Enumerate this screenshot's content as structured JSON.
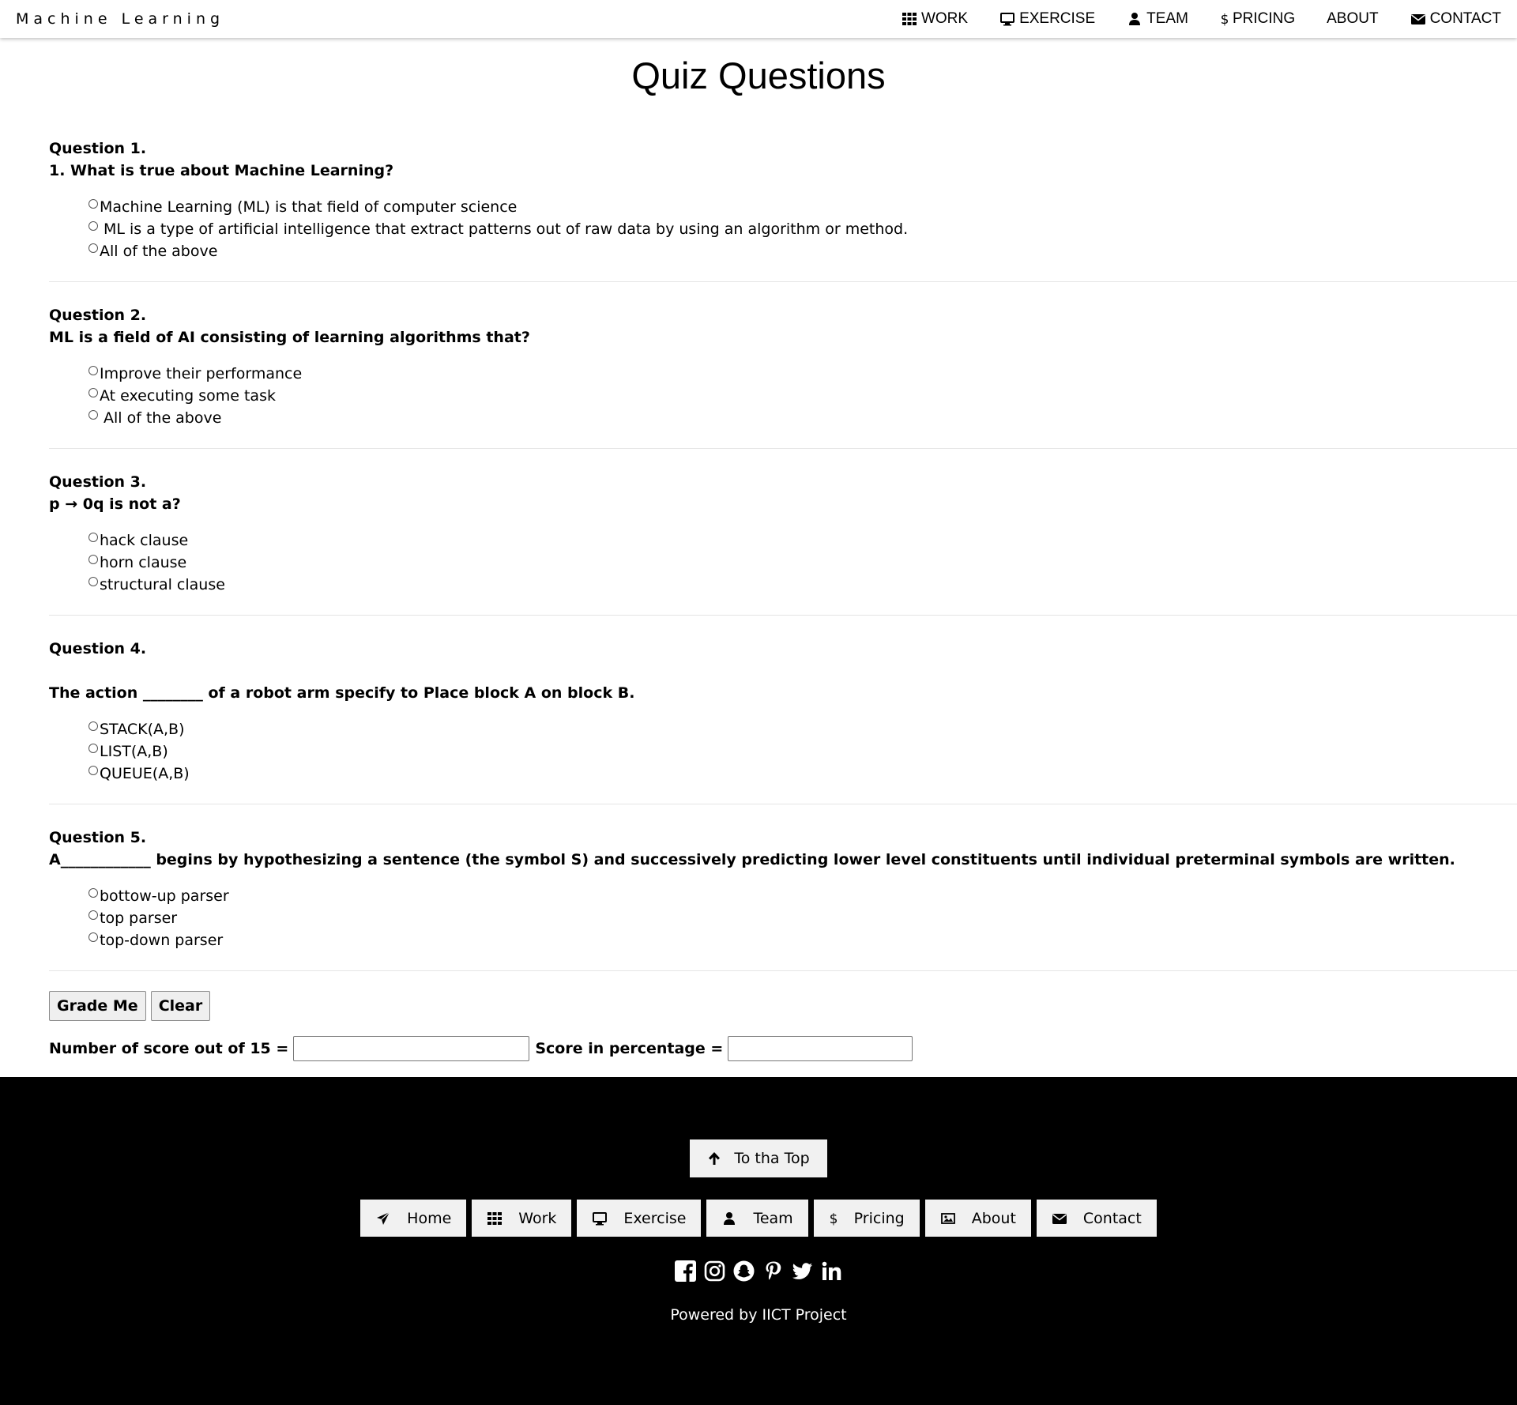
{
  "navbar": {
    "brand": "Machine Learning",
    "items": [
      {
        "label": "WORK",
        "icon": "th-grid-icon"
      },
      {
        "label": "EXERCISE",
        "icon": "desktop-icon"
      },
      {
        "label": "TEAM",
        "icon": "user-icon"
      },
      {
        "label": "PRICING",
        "icon": "dollar-icon"
      },
      {
        "label": "ABOUT",
        "icon": ""
      },
      {
        "label": "CONTACT",
        "icon": "envelope-icon"
      }
    ]
  },
  "main": {
    "title": "Quiz Questions",
    "questions": [
      {
        "number": "Question 1.",
        "text": "1. What is true about Machine Learning?",
        "options": [
          "Machine Learning (ML) is that field of computer science",
          "ML is a type of artificial intelligence that extract patterns out of raw data by using an algorithm or method.",
          "All of the above"
        ]
      },
      {
        "number": "Question 2.",
        "text": "ML is a field of AI consisting of learning algorithms that?",
        "options": [
          "Improve their performance",
          "At executing some task",
          "All of the above"
        ]
      },
      {
        "number": "Question 3.",
        "text": "p → 0q is not a?",
        "options": [
          "hack clause",
          "horn clause",
          "structural clause"
        ]
      },
      {
        "number": "Question 4.",
        "text": "The action ________ of a robot arm specify to Place block A on block B.",
        "options": [
          "STACK(A,B)",
          "LIST(A,B)",
          "QUEUE(A,B)"
        ]
      },
      {
        "number": "Question 5.",
        "text": "A____________ begins by hypothesizing a sentence (the symbol S) and successively predicting lower level constituents until individual preterminal symbols are written.",
        "options": [
          "bottow-up parser",
          "top parser",
          "top-down parser"
        ]
      }
    ],
    "grade_button": "Grade Me",
    "clear_button": "Clear",
    "score_label": "Number of score out of 15 =",
    "score_value": "",
    "percentage_label": "Score in percentage =",
    "percentage_value": ""
  },
  "footer": {
    "top_button": "To tha Top",
    "nav": [
      {
        "label": "Home",
        "icon": "paper-plane-icon"
      },
      {
        "label": "Work",
        "icon": "th-grid-icon"
      },
      {
        "label": "Exercise",
        "icon": "desktop-icon"
      },
      {
        "label": "Team",
        "icon": "user-icon"
      },
      {
        "label": "Pricing",
        "icon": "dollar-icon"
      },
      {
        "label": "About",
        "icon": "image-icon"
      },
      {
        "label": "Contact",
        "icon": "envelope-icon"
      }
    ],
    "socials": [
      "facebook-icon",
      "instagram-icon",
      "snapchat-icon",
      "pinterest-icon",
      "twitter-icon",
      "linkedin-icon"
    ],
    "powered_by": "Powered by IICT Project"
  }
}
